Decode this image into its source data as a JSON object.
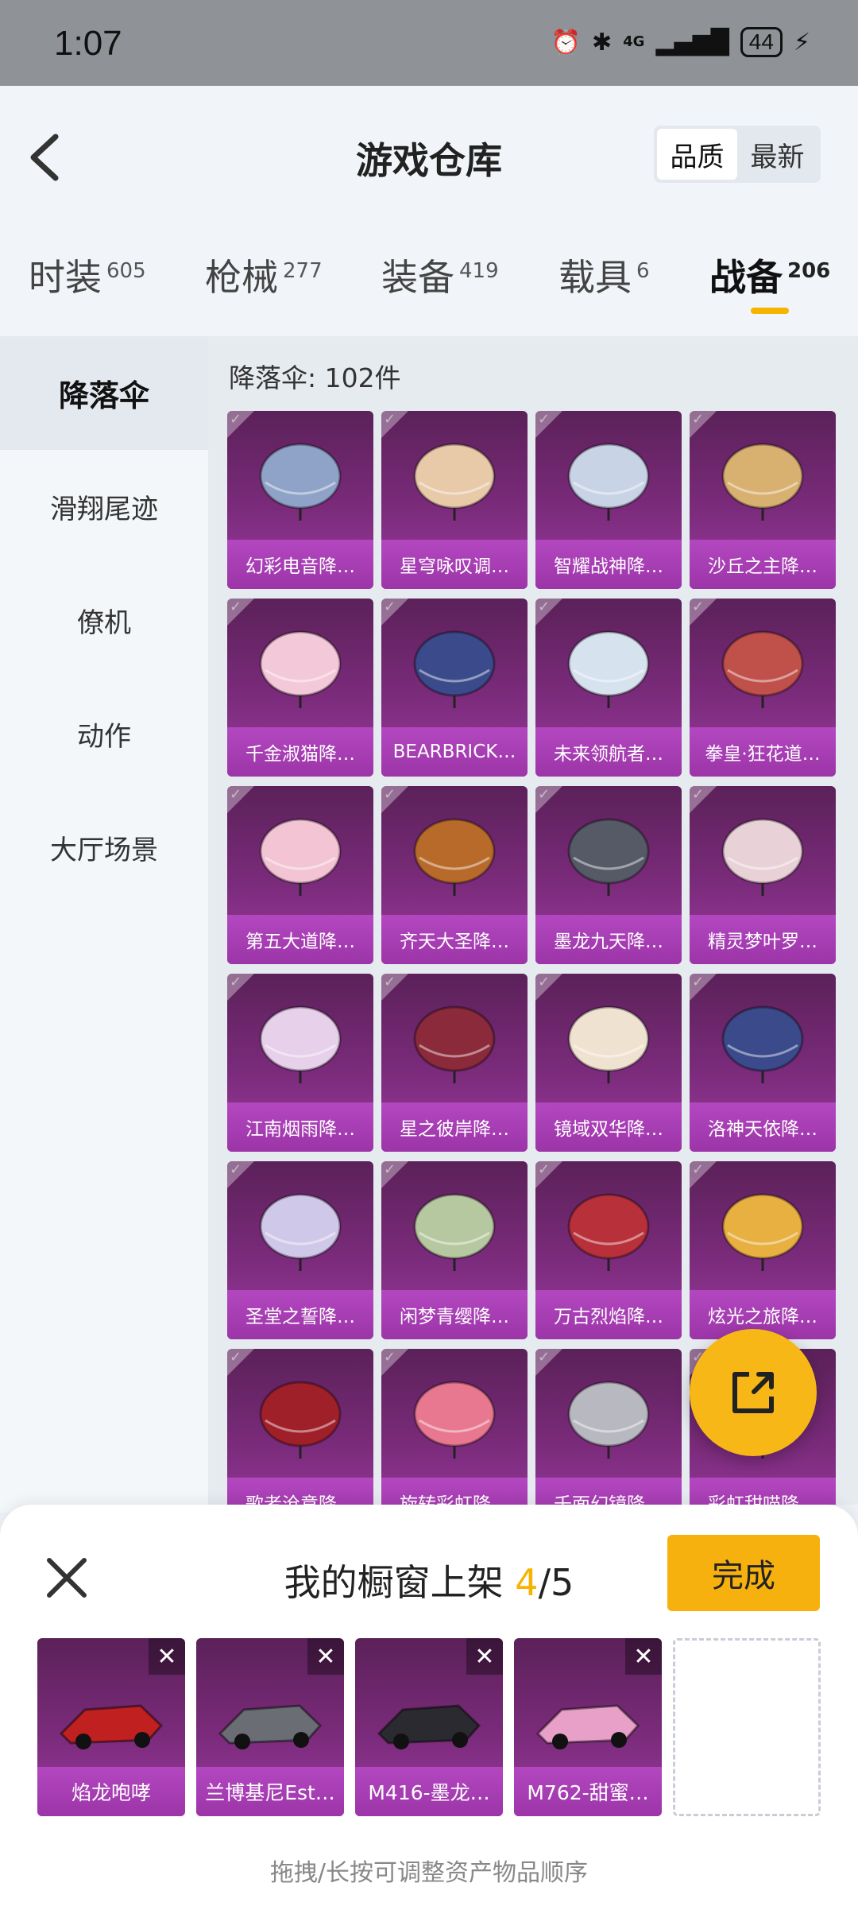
{
  "status_bar": {
    "time": "1:07",
    "network": "4G",
    "battery": "44"
  },
  "header": {
    "title": "游戏仓库",
    "sort_options": [
      "品质",
      "最新"
    ],
    "active_sort": "品质"
  },
  "tabs": [
    {
      "label": "时装",
      "count": "605"
    },
    {
      "label": "枪械",
      "count": "277"
    },
    {
      "label": "装备",
      "count": "419"
    },
    {
      "label": "载具",
      "count": "6"
    },
    {
      "label": "战备",
      "count": "206"
    }
  ],
  "active_tab": "战备",
  "sidebar": {
    "items": [
      {
        "label": "降落伞"
      },
      {
        "label": "滑翔尾迹"
      },
      {
        "label": "僚机"
      },
      {
        "label": "动作"
      },
      {
        "label": "大厅场景"
      }
    ],
    "active": "降落伞"
  },
  "content": {
    "count_label": "降落伞: 102件",
    "items": [
      {
        "name": "幻彩电音降…",
        "color": "#8fa2c8"
      },
      {
        "name": "星穹咏叹调…",
        "color": "#e8c9a8"
      },
      {
        "name": "智耀战神降…",
        "color": "#c8d4e6"
      },
      {
        "name": "沙丘之主降…",
        "color": "#d8b070"
      },
      {
        "name": "千金淑猫降…",
        "color": "#f3c8d8"
      },
      {
        "name": "BEARBRICK…",
        "color": "#3b4a8a"
      },
      {
        "name": "未来领航者…",
        "color": "#d6e2ee"
      },
      {
        "name": "拳皇·狂花道…",
        "color": "#c0504a"
      },
      {
        "name": "第五大道降…",
        "color": "#f2c4d4"
      },
      {
        "name": "齐天大圣降…",
        "color": "#b86a2a"
      },
      {
        "name": "墨龙九天降…",
        "color": "#555a66"
      },
      {
        "name": "精灵梦叶罗…",
        "color": "#e8d2d8"
      },
      {
        "name": "江南烟雨降…",
        "color": "#e6d0ea"
      },
      {
        "name": "星之彼岸降…",
        "color": "#8a2a3a"
      },
      {
        "name": "镜域双华降…",
        "color": "#f0e2d0"
      },
      {
        "name": "洛神天依降…",
        "color": "#3a4a8a"
      },
      {
        "name": "圣堂之誓降…",
        "color": "#d0c8e8"
      },
      {
        "name": "闲梦青缨降…",
        "color": "#b6c8a0"
      },
      {
        "name": "万古烈焰降…",
        "color": "#b8303a"
      },
      {
        "name": "炫光之旅降…",
        "color": "#e8b040"
      },
      {
        "name": "歌者沧意降…",
        "color": "#a0202a"
      },
      {
        "name": "旋转彩虹降…",
        "color": "#e87890"
      },
      {
        "name": "千面幻镜降…",
        "color": "#b8b8c0"
      },
      {
        "name": "彩虹甜喵降…",
        "color": "#f0c0d8"
      }
    ]
  },
  "panel": {
    "title_prefix": "我的橱窗上架 ",
    "current": "4",
    "total": "/5",
    "done_label": "完成",
    "shelf": [
      {
        "name": "焰龙咆哮",
        "color": "#c02020"
      },
      {
        "name": "兰博基尼Est…",
        "color": "#6a6e74"
      },
      {
        "name": "M416-墨龙…",
        "color": "#2a2a30"
      },
      {
        "name": "M762-甜蜜…",
        "color": "#e8a0c8"
      }
    ],
    "hint": "拖拽/长按可调整资产物品顺序"
  }
}
